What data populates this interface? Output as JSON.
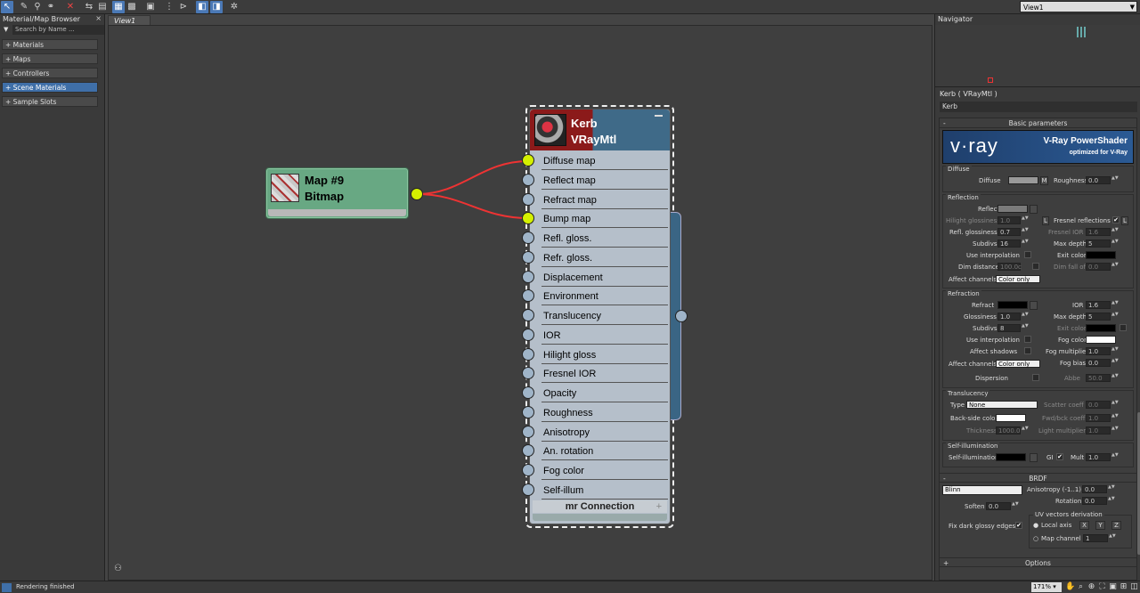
{
  "toolbar": {
    "icons": [
      "select-icon",
      "pick-material-icon",
      "material-to-selected-icon",
      "assign-icon",
      "delete-icon",
      "move-children-icon",
      "hide-unused-icon",
      "show-map-icon",
      "show-background-icon",
      "show-end-result-icon",
      "layout-children-icon",
      "layout-all-icon",
      "select-tool-active-icon",
      "select-view-icon",
      "material-id-icon"
    ],
    "view_select": "View1"
  },
  "browser": {
    "title": "Material/Map Browser",
    "close": "×",
    "search_placeholder": "Search by Name ...",
    "categories": [
      "+ Materials",
      "+ Maps",
      "+ Controllers",
      "+ Scene Materials",
      "+ Sample Slots"
    ],
    "selected_index": 3
  },
  "view_tab": "View1",
  "bitmap_node": {
    "name": "Map #9",
    "type": "Bitmap"
  },
  "vray_node": {
    "name": "Kerb",
    "type": "VRayMtl",
    "slots": [
      "Diffuse map",
      "Reflect map",
      "Refract map",
      "Bump map",
      "Refl. gloss.",
      "Refr. gloss.",
      "Displacement",
      "Environment",
      "Translucency",
      "IOR",
      "Hilight gloss",
      "Fresnel IOR",
      "Opacity",
      "Roughness",
      "Anisotropy",
      "An. rotation",
      "Fog color",
      "Self-illum"
    ],
    "connected_slots": [
      0,
      3
    ],
    "mr_connection": "mr Connection",
    "plus": "+"
  },
  "navigator": {
    "title": "Navigator"
  },
  "material_panel": {
    "title": "Kerb  ( VRayMtl )",
    "name_field": "Kerb",
    "basic_title": "Basic parameters",
    "banner": {
      "logo": "v·ray",
      "line1": "V-Ray PowerShader",
      "line2": "optimized for V-Ray"
    },
    "diffuse": {
      "group": "Diffuse",
      "label": "Diffuse",
      "m": "M",
      "roughness_label": "Roughness",
      "roughness": "0.0"
    },
    "reflection": {
      "group": "Reflection",
      "reflect_label": "Reflect",
      "hilight_label": "Hilight glossiness",
      "hilight": "1.0",
      "l": "L",
      "fresnel_label": "Fresnel reflections",
      "fresnel_check": "✔",
      "fresnel_l": "L",
      "refl_gloss_label": "Refl. glossiness",
      "refl_gloss": "0.7",
      "fresnel_ior_label": "Fresnel IOR",
      "fresnel_ior": "1.6",
      "subdivs_label": "Subdivs",
      "subdivs": "16",
      "max_depth_label": "Max depth",
      "max_depth": "5",
      "use_interp_label": "Use interpolation",
      "exit_color_label": "Exit color",
      "dim_distance_label": "Dim distance",
      "dim_distance": "100.0c",
      "dim_falloff_label": "Dim fall off",
      "dim_falloff": "0.0",
      "affect_label": "Affect channels",
      "affect": "Color only"
    },
    "refraction": {
      "group": "Refraction",
      "refract_label": "Refract",
      "ior_label": "IOR",
      "ior": "1.6",
      "gloss_label": "Glossiness",
      "gloss": "1.0",
      "max_depth_label": "Max depth",
      "max_depth": "5",
      "subdivs_label": "Subdivs",
      "subdivs": "8",
      "exit_color_label": "Exit color",
      "use_interp_label": "Use interpolation",
      "fog_color_label": "Fog color",
      "affect_shadows_label": "Affect shadows",
      "fog_mult_label": "Fog multiplier",
      "fog_mult": "1.0",
      "affect_label": "Affect channels",
      "affect": "Color only",
      "fog_bias_label": "Fog bias",
      "fog_bias": "0.0",
      "dispersion_label": "Dispersion",
      "abbe_label": "Abbe",
      "abbe": "50.0"
    },
    "translucency": {
      "group": "Translucency",
      "type_label": "Type",
      "type": "None",
      "scatter_label": "Scatter coeff",
      "scatter": "0.0",
      "backside_label": "Back-side color",
      "fwd_label": "Fwd/bck coeff",
      "fwd": "1.0",
      "thickness_label": "Thickness",
      "thickness": "1000.0",
      "light_mult_label": "Light multiplier",
      "light_mult": "1.0"
    },
    "self_illum": {
      "group": "Self-illumination",
      "label": "Self-illumination",
      "gi_label": "GI",
      "gi_check": "✔",
      "mult_label": "Mult",
      "mult": "1.0"
    },
    "brdf": {
      "title": "BRDF",
      "type": "Blinn",
      "anisotropy_label": "Anisotropy (-1..1)",
      "anisotropy": "0.0",
      "rotation_label": "Rotation",
      "rotation": "0.0",
      "soften_label": "Soften",
      "soften": "0.0",
      "uv_label": "UV vectors derivation",
      "fix_label": "Fix dark glossy edges",
      "fix_check": "✔",
      "local_axis_label": "Local axis",
      "x": "X",
      "y": "Y",
      "z": "Z",
      "map_channel_label": "Map channel",
      "map_channel": "1"
    },
    "options_title": "Options",
    "minus": "-",
    "plus": "+"
  },
  "status": {
    "message": "Rendering finished",
    "zoom": "171%"
  }
}
